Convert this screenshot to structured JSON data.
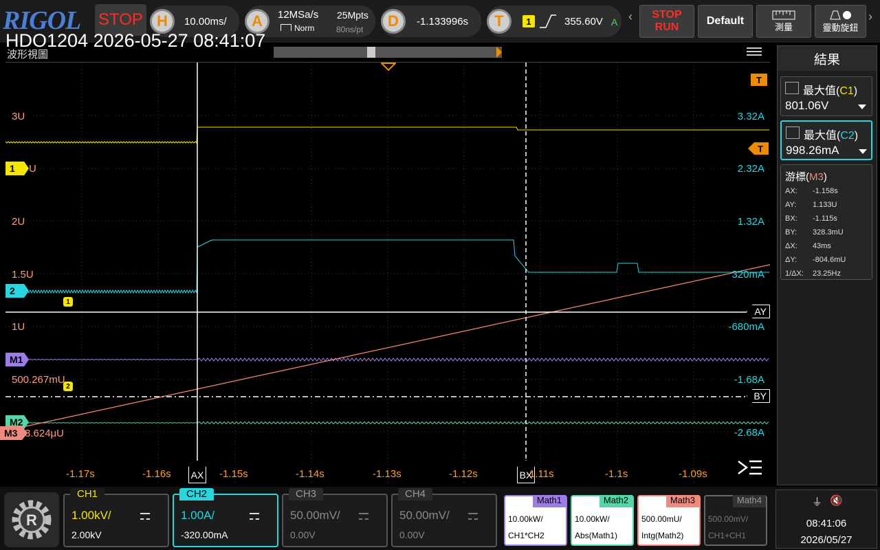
{
  "header": {
    "logo": "RIGOL",
    "run_state": "STOP",
    "horizontal": {
      "letter": "H",
      "timebase": "10.00ms/"
    },
    "acquire": {
      "letter": "A",
      "sample_rate": "12MSa/s",
      "mode": "Norm",
      "memory": "25Mpts",
      "sample_interval": "80ns/pt"
    },
    "delay": {
      "letter": "D",
      "value": "-1.133996s"
    },
    "trigger": {
      "letter": "T",
      "source": "1",
      "level": "355.60V",
      "coupling": "A"
    },
    "buttons": {
      "stop_label": "STOP",
      "run_label": "RUN",
      "default_label": "Default",
      "measure_label": "測量",
      "knob_label": "靈動旋鈕"
    }
  },
  "overlay_title": "HDO1204 2026-05-27 08:41:07",
  "view_label": "波形視圖",
  "scope": {
    "left_labels": [
      "3U",
      "2U",
      "1.5U",
      "1U",
      "500.267mU",
      "3.624μU"
    ],
    "left_unit_ch1": "U",
    "right_labels": [
      "3.32A",
      "2.32A",
      "1.32A",
      "320mA",
      "-680mA",
      "-1.68A",
      "-2.68A"
    ],
    "time_ticks": [
      "-1.17s",
      "-1.16s",
      "-1.15s",
      "-1.14s",
      "-1.13s",
      "-1.12s",
      "-1.11s",
      "-1.1s",
      "-1.09s"
    ],
    "markers": {
      "ch1": "1",
      "ch2": "2",
      "m1": "M1",
      "m2": "M2",
      "m3": "M3",
      "trig": "T",
      "ax": "AX",
      "bx": "BX",
      "ay": "AY",
      "by": "BY",
      "p1": "1",
      "p2": "2"
    }
  },
  "results": {
    "title": "結果",
    "meas1": {
      "label": "最大值",
      "src": "C1",
      "value": "801.06V"
    },
    "meas2": {
      "label": "最大值",
      "src": "C2",
      "value": "998.26mA"
    },
    "cursor_title": "游標",
    "cursor_src": "M3",
    "cursor_rows": [
      {
        "k": "AX:",
        "v": "-1.158s"
      },
      {
        "k": "AY:",
        "v": "1.133U"
      },
      {
        "k": "BX:",
        "v": "-1.115s"
      },
      {
        "k": "BY:",
        "v": "328.3mU"
      },
      {
        "k": "ΔX:",
        "v": "43ms"
      },
      {
        "k": "ΔY:",
        "v": "-804.6mU"
      },
      {
        "k": "1/ΔX:",
        "v": "23.25Hz"
      }
    ]
  },
  "channels": [
    {
      "name": "CH1",
      "scale": "1.00kV/",
      "offset": "2.00kV",
      "color": "#f5e600"
    },
    {
      "name": "CH2",
      "scale": "1.00A/",
      "offset": "-320.00mA",
      "color": "#26d7e0"
    },
    {
      "name": "CH3",
      "scale": "50.00mV/",
      "offset": "0.00V",
      "color": "#8a8a8a"
    },
    {
      "name": "CH4",
      "scale": "50.00mV/",
      "offset": "0.00V",
      "color": "#8a8a8a"
    }
  ],
  "maths": [
    {
      "name": "Math1",
      "scale": "10.00kW/",
      "expr": "CH1*CH2",
      "color": "#9d7ce6"
    },
    {
      "name": "Math2",
      "scale": "10.00kW/",
      "expr": "Abs(Math1)",
      "color": "#56d6a6"
    },
    {
      "name": "Math3",
      "scale": "500.00mU/",
      "expr": "Intg(Math2)",
      "color": "#f08a80"
    },
    {
      "name": "Math4",
      "scale": "500.00mV/",
      "expr": "CH1+CH1",
      "color": "#666666"
    }
  ],
  "status": {
    "time": "08:41:06",
    "date": "2026/05/27"
  }
}
